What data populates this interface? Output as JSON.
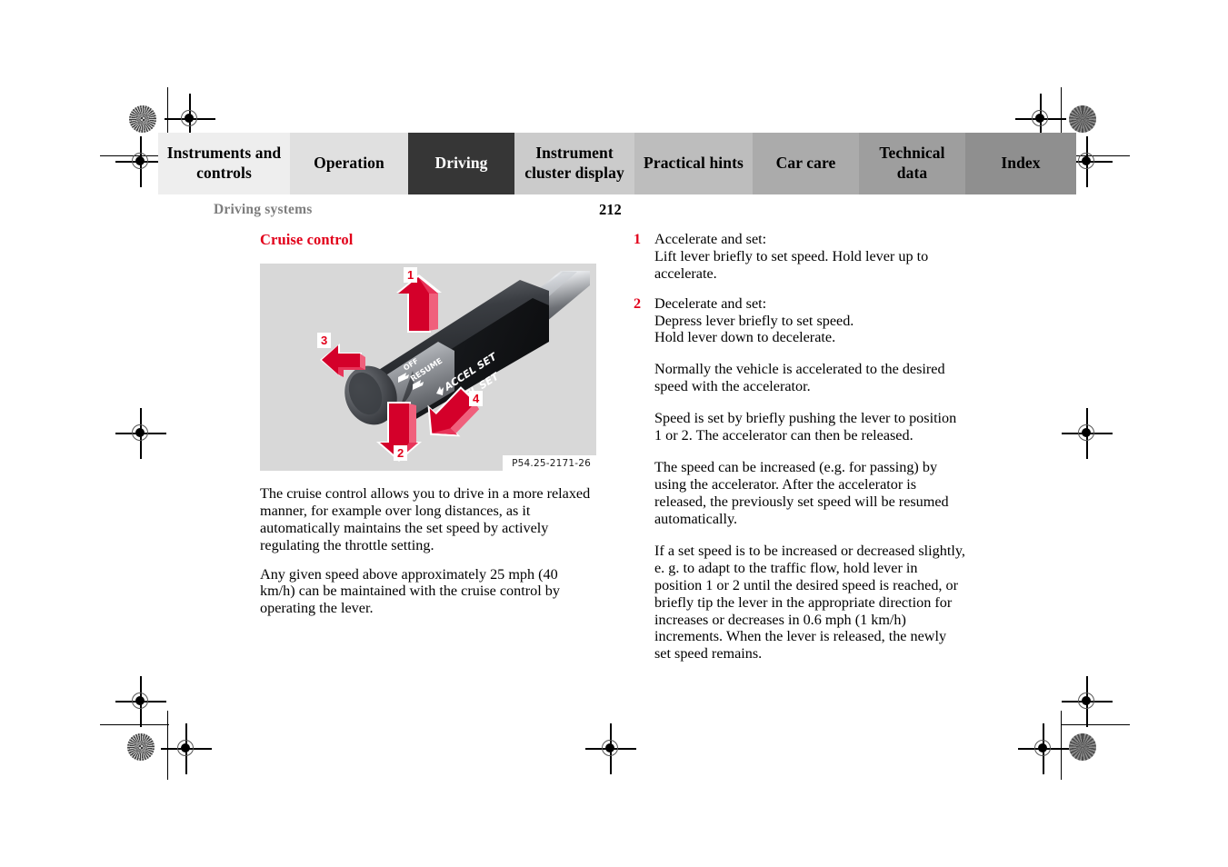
{
  "tabs": [
    {
      "label": "Instruments and controls",
      "active": false,
      "bg": "#eeeeee"
    },
    {
      "label": "Operation",
      "active": false,
      "bg": "#e0e0e0"
    },
    {
      "label": "Driving",
      "active": true,
      "bg": "#363636"
    },
    {
      "label": "Instrument cluster display",
      "active": false,
      "bg": "#cbcbcb"
    },
    {
      "label": "Practical hints",
      "active": false,
      "bg": "#bdbdbd"
    },
    {
      "label": "Car care",
      "active": false,
      "bg": "#ababab"
    },
    {
      "label": "Technical data",
      "active": false,
      "bg": "#9e9e9e"
    },
    {
      "label": "Index",
      "active": false,
      "bg": "#8f8f8f"
    }
  ],
  "header": {
    "running_head": "Driving systems",
    "page_number": "212"
  },
  "left_column": {
    "section_title": "Cruise control",
    "figure": {
      "caption": "P54.25-2171-26",
      "callouts": [
        "1",
        "2",
        "3",
        "4"
      ],
      "lever_labels": [
        "OFF",
        "RESUME",
        "ACCEL SET",
        "DECEL SET"
      ]
    },
    "paragraphs": [
      "The cruise control allows you to drive in a more relaxed manner, for example over long distances, as it automatically maintains the set speed by actively regulating the throttle setting.",
      "Any given speed above approximately 25 mph (40 km/h) can be maintained with the cruise control by operating the lever."
    ]
  },
  "right_column": {
    "items": [
      {
        "num": "1",
        "lines": [
          "Accelerate and set:",
          "Lift lever briefly to set speed. Hold lever up to accelerate."
        ]
      },
      {
        "num": "2",
        "lines": [
          "Decelerate and set:",
          "Depress lever briefly to set speed.",
          "Hold lever down to decelerate."
        ]
      }
    ],
    "paragraphs": [
      "Normally the vehicle is accelerated to the desired speed with the accelerator.",
      "Speed is set by briefly pushing the lever to position 1 or 2. The accelerator can then be released.",
      "The speed can be increased (e.g. for passing) by using the accelerator. After the accelerator is released, the previously set speed will be resumed automatically.",
      "If a set speed is to be increased or decreased slightly, e. g. to adapt to the traffic flow, hold lever in position 1 or 2 until the desired speed is reached, or briefly tip the lever in the appropriate direction for increases or decreases in 0.6 mph (1 km/h) increments. When the lever is released, the newly set speed remains."
    ]
  },
  "colors": {
    "accent_red": "#e2001a",
    "active_tab_bg": "#363636",
    "running_head_gray": "#7d7d7d",
    "figure_bg": "#d8d8d8"
  }
}
